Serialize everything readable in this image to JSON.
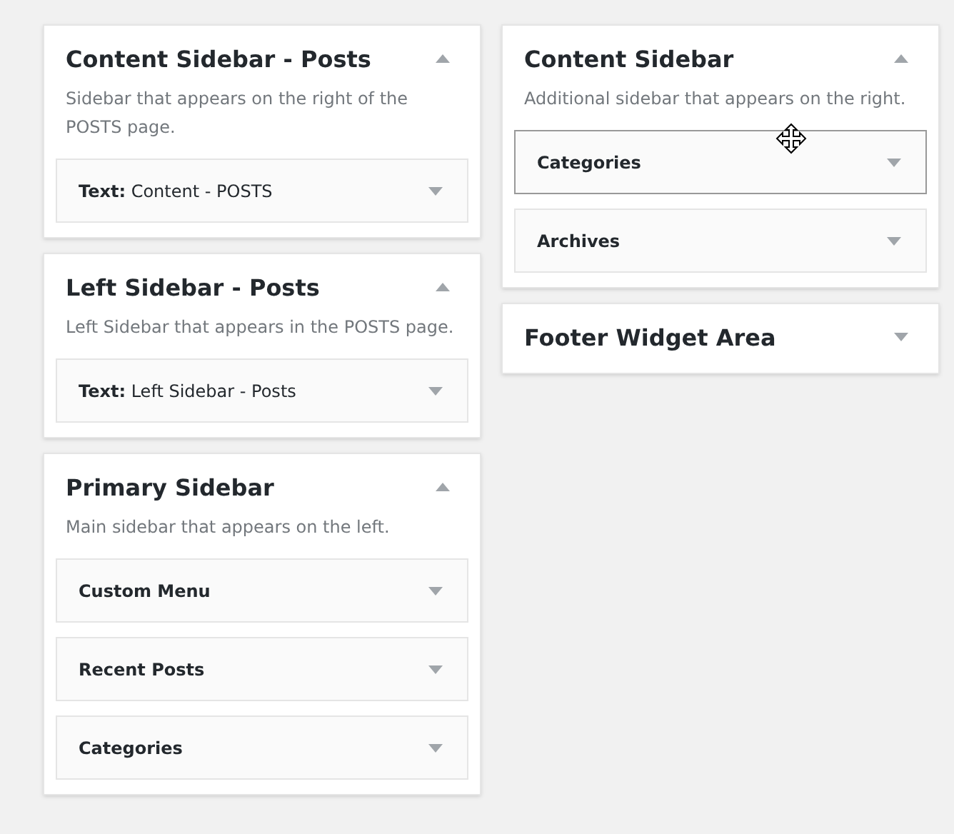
{
  "columns": [
    {
      "sidebars": [
        {
          "title": "Content Sidebar - Posts",
          "description": "Sidebar that appears on the right of the POSTS page.",
          "expanded": true,
          "widgets": [
            {
              "title": "**Text:** Content - POSTS",
              "highlighted": false
            }
          ]
        },
        {
          "title": "Left Sidebar - Posts",
          "description": "Left Sidebar that appears in the POSTS page.",
          "expanded": true,
          "widgets": [
            {
              "title": "**Text:** Left Sidebar - Posts",
              "highlighted": false
            }
          ]
        },
        {
          "title": "Primary Sidebar",
          "description": "Main sidebar that appears on the left.",
          "expanded": true,
          "widgets": [
            {
              "title": "**Custom Menu**",
              "highlighted": false
            },
            {
              "title": "**Recent Posts**",
              "highlighted": false
            },
            {
              "title": "**Categories**",
              "highlighted": false
            }
          ]
        }
      ]
    },
    {
      "sidebars": [
        {
          "title": "Content Sidebar",
          "description": "Additional sidebar that appears on the right.",
          "expanded": true,
          "widgets": [
            {
              "title": "**Categories**",
              "highlighted": true
            },
            {
              "title": "**Archives**",
              "highlighted": false
            }
          ]
        },
        {
          "title": "Footer Widget Area",
          "expanded": false
        }
      ]
    }
  ]
}
